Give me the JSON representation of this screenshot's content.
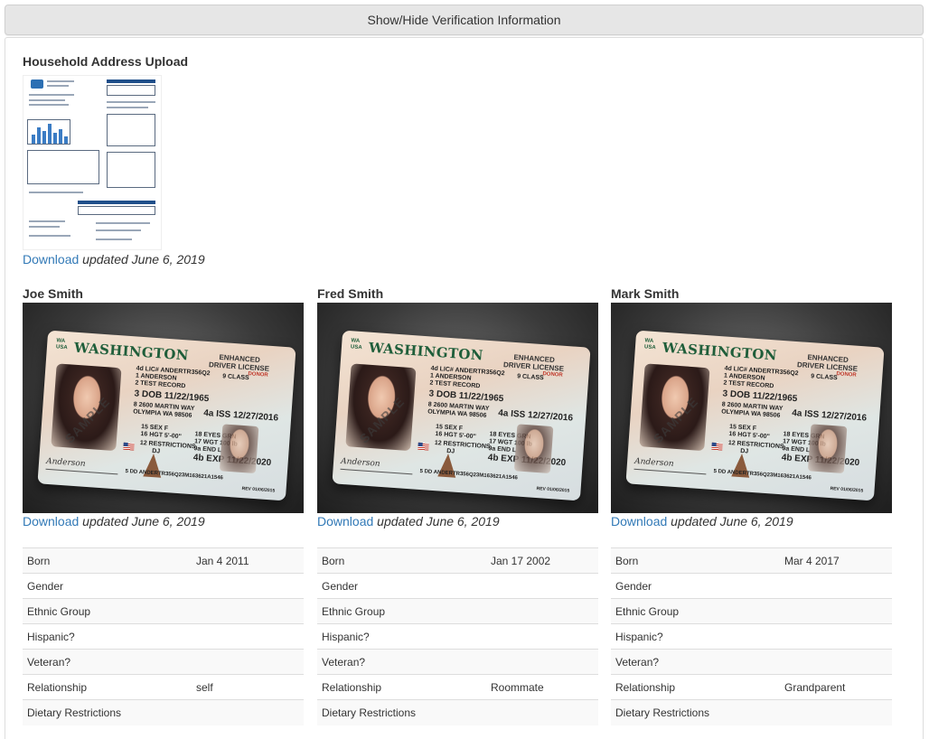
{
  "toggle": {
    "label": "Show/Hide Verification Information"
  },
  "household": {
    "title": "Household Address Upload",
    "download_label": "Download",
    "updated_text": "updated June 6, 2019"
  },
  "people": [
    {
      "name": "Joe Smith",
      "download_label": "Download",
      "updated_text": "updated June 6, 2019",
      "fields": [
        {
          "label": "Born",
          "value": "Jan 4 2011"
        },
        {
          "label": "Gender",
          "value": ""
        },
        {
          "label": "Ethnic Group",
          "value": ""
        },
        {
          "label": "Hispanic?",
          "value": ""
        },
        {
          "label": "Veteran?",
          "value": ""
        },
        {
          "label": "Relationship",
          "value": "self"
        },
        {
          "label": "Dietary Restrictions",
          "value": ""
        }
      ]
    },
    {
      "name": "Fred Smith",
      "download_label": "Download",
      "updated_text": "updated June 6, 2019",
      "fields": [
        {
          "label": "Born",
          "value": "Jan 17 2002"
        },
        {
          "label": "Gender",
          "value": ""
        },
        {
          "label": "Ethnic Group",
          "value": ""
        },
        {
          "label": "Hispanic?",
          "value": ""
        },
        {
          "label": "Veteran?",
          "value": ""
        },
        {
          "label": "Relationship",
          "value": "Roommate"
        },
        {
          "label": "Dietary Restrictions",
          "value": ""
        }
      ]
    },
    {
      "name": "Mark Smith",
      "download_label": "Download",
      "updated_text": "updated June 6, 2019",
      "fields": [
        {
          "label": "Born",
          "value": "Mar 4 2017"
        },
        {
          "label": "Gender",
          "value": ""
        },
        {
          "label": "Ethnic Group",
          "value": ""
        },
        {
          "label": "Hispanic?",
          "value": ""
        },
        {
          "label": "Veteran?",
          "value": ""
        },
        {
          "label": "Relationship",
          "value": "Grandparent"
        },
        {
          "label": "Dietary Restrictions",
          "value": ""
        }
      ]
    }
  ],
  "id_card": {
    "state": "WASHINGTON",
    "state_abbr": "WA\nUSA",
    "doc_type": "ENHANCED\nDRIVER LICENSE",
    "license_no": "4d LIC# ANDERTR356Q2",
    "last_name": "1 ANDERSON",
    "first_name": "2 TEST RECORD",
    "class": "9 CLASS",
    "donor": "DONOR",
    "dob": "3 DOB 11/22/1965",
    "address1": "8 2600 MARTIN WAY",
    "address2": "OLYMPIA WA 98506",
    "iss": "4a ISS 12/27/2016",
    "sex": "15 SEX F",
    "hgt": "16 HGT 5'-00\"",
    "eyes": "18 EYES GRN",
    "wgt": "17 WGT 100 lb",
    "restrictions": "12 RESTRICTIONS",
    "restr_val": "DJ",
    "end": "9a END L",
    "exp": "4b EXP 11/22/2020",
    "dd": "5 DD ANDERTR356Q23M163621A1546",
    "rev": "REV 01/06/2015",
    "sample": "SAMPLE",
    "signature": "Anderson"
  }
}
